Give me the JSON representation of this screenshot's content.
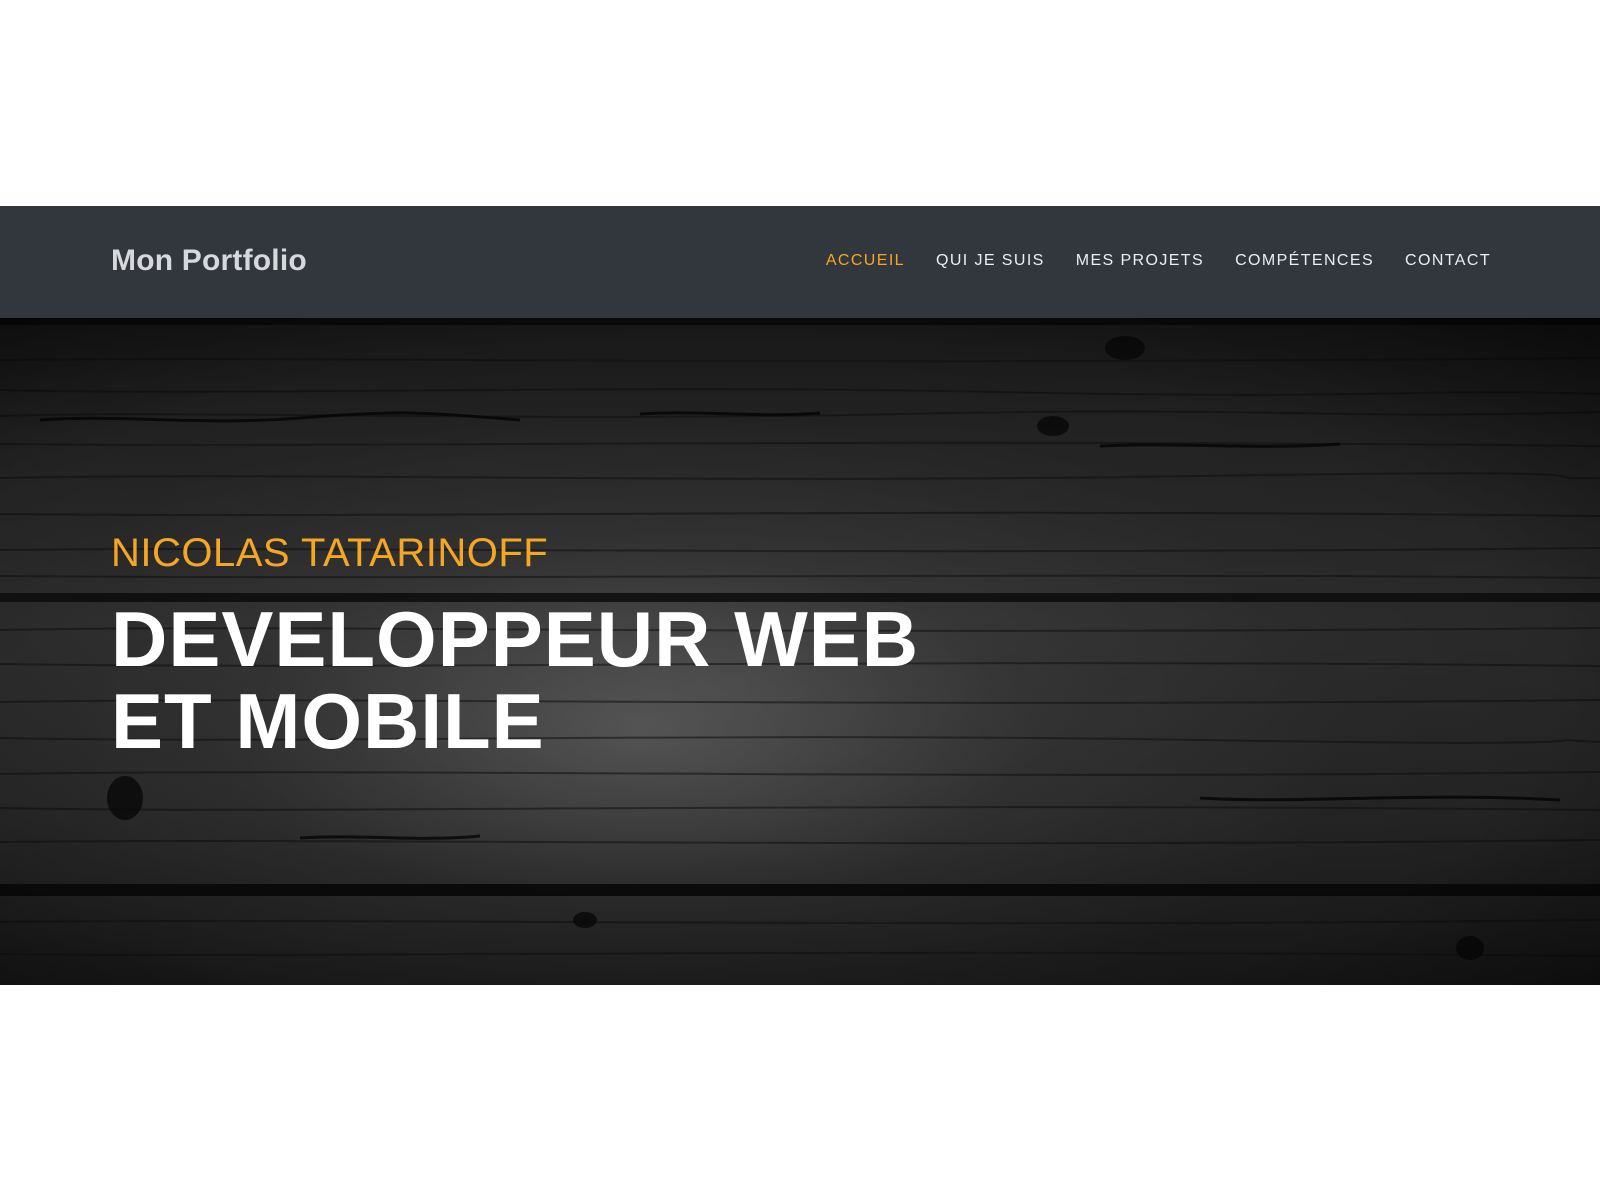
{
  "navbar": {
    "brand": "Mon Portfolio",
    "links": [
      {
        "label": "ACCUEIL",
        "active": true
      },
      {
        "label": "QUI JE SUIS",
        "active": false
      },
      {
        "label": "MES PROJETS",
        "active": false
      },
      {
        "label": "COMPÉTENCES",
        "active": false
      },
      {
        "label": "CONTACT",
        "active": false
      }
    ]
  },
  "hero": {
    "subtitle": "NICOLAS TATARINOFF",
    "title_line_1": "DEVELOPPEUR WEB",
    "title_line_2": "ET MOBILE"
  },
  "colors": {
    "navbar_background": "#32363d",
    "accent": "#f5a623",
    "hero_text": "#ffffff",
    "nav_text": "#eceef2",
    "page_background": "#ffffff"
  }
}
